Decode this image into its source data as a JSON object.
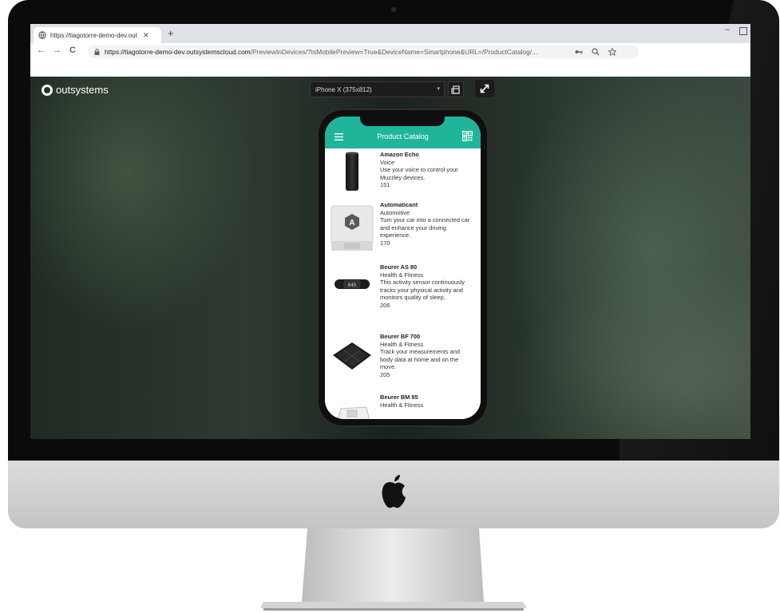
{
  "browser": {
    "tab_title": "https://tiagotorre-demo-dev.out",
    "tab_close": "✕",
    "new_tab": "+",
    "window_minimize": "–",
    "nav": {
      "back": "←",
      "forward": "→",
      "reload": "C"
    },
    "url_host": "https://tiagotorre-demo-dev.outsystemscloud.com",
    "url_path": "/PreviewInDevices/?IsMobilePreview=True&DeviceName=Smartphone&URL=/ProductCatalog/...",
    "icons": [
      "lock-icon",
      "key-icon",
      "zoom-icon",
      "star-icon"
    ]
  },
  "preview": {
    "brand": "outsystems",
    "device_selected": "iPhone X (375x812)",
    "caret": "▾"
  },
  "app": {
    "title": "Product Catalog",
    "accent": "#1fb59b",
    "products": [
      {
        "name": "Amazon Echo",
        "category": "Voice",
        "description": "Use your voice to control your Muzzley devices.",
        "number": "151"
      },
      {
        "name": "Automaticant",
        "category": "Automotive",
        "description": "Turn your car into a connected car and enhance your driving experience.",
        "number": "170"
      },
      {
        "name": "Beurer AS 80",
        "category": "Health & Fitness",
        "description": "This activity sensor continuously tracks your physical activity and monitors quality of sleep.",
        "number": "206"
      },
      {
        "name": "Beurer BF 700",
        "category": "Health & Fitness",
        "description": "Track your measurements and body data at home and on the move.",
        "number": "205"
      },
      {
        "name": "Beurer BM 85",
        "category": "Health & Fitness",
        "description": "",
        "number": ""
      }
    ]
  }
}
